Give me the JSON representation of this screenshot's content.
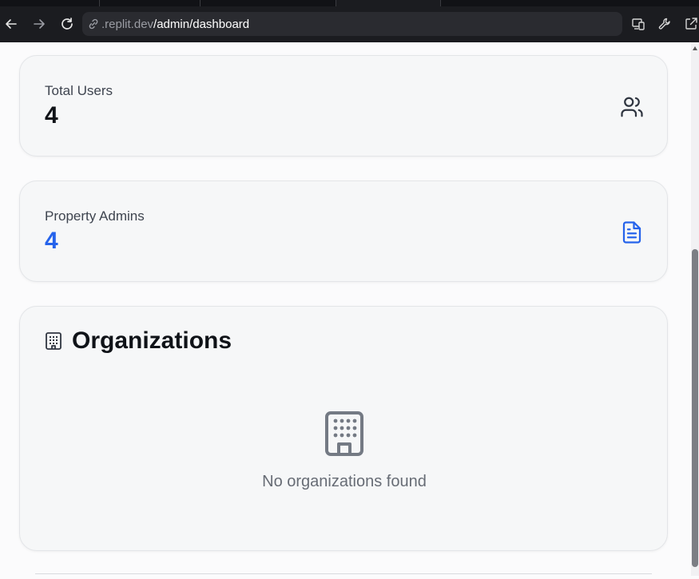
{
  "browser": {
    "url_host": ".replit.dev",
    "url_path": "/admin/dashboard",
    "icons": {
      "back": "arrow-left-icon",
      "forward": "arrow-right-icon",
      "reload": "reload-icon",
      "link": "link-icon",
      "devices": "devices-icon",
      "tools": "wrench-icon",
      "open_external": "open-external-icon"
    }
  },
  "stats": {
    "total_users": {
      "label": "Total Users",
      "value": "4",
      "icon": "users-icon"
    },
    "property_admins": {
      "label": "Property Admins",
      "value": "4",
      "icon": "document-icon"
    }
  },
  "organizations": {
    "title": "Organizations",
    "title_icon": "building-icon",
    "empty_icon": "building-icon",
    "empty_message": "No organizations found"
  },
  "colors": {
    "accent": "#2563eb",
    "text_dark": "#101318",
    "muted": "#6b7280",
    "browser_bg": "#1b1c20"
  }
}
